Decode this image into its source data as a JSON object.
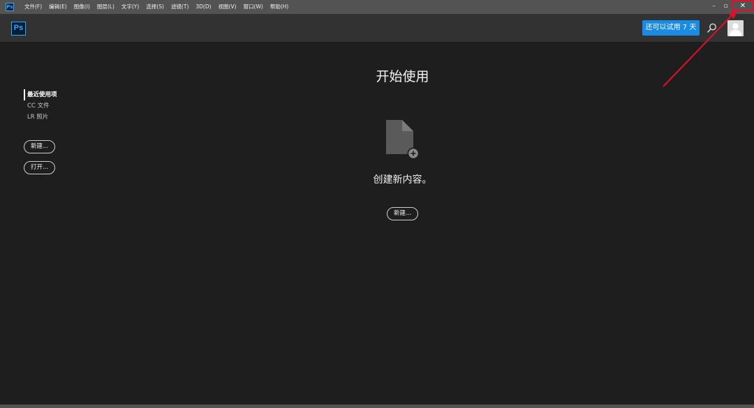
{
  "menubar": {
    "logo": "Ps",
    "items": [
      "文件(F)",
      "编辑(E)",
      "图像(I)",
      "图层(L)",
      "文字(Y)",
      "选择(S)",
      "滤镜(T)",
      "3D(D)",
      "视图(V)",
      "窗口(W)",
      "帮助(H)"
    ],
    "minimize": "–",
    "restore": "▫",
    "close": "✕"
  },
  "header": {
    "logo": "Ps",
    "trial_label": "还可以试用 7 天"
  },
  "sidebar": {
    "items": [
      {
        "label": "最近使用项",
        "active": true
      },
      {
        "label": "CC 文件",
        "active": false
      },
      {
        "label": "LR 照片",
        "active": false
      }
    ],
    "new_label": "新建...",
    "open_label": "打开..."
  },
  "main": {
    "title": "开始使用",
    "subtitle": "创建新内容。",
    "new_label": "新建..."
  },
  "colors": {
    "accent": "#1b8ae5",
    "ps_blue": "#31a8ff",
    "background": "#1e1e1e",
    "annotation": "#e0102a"
  }
}
